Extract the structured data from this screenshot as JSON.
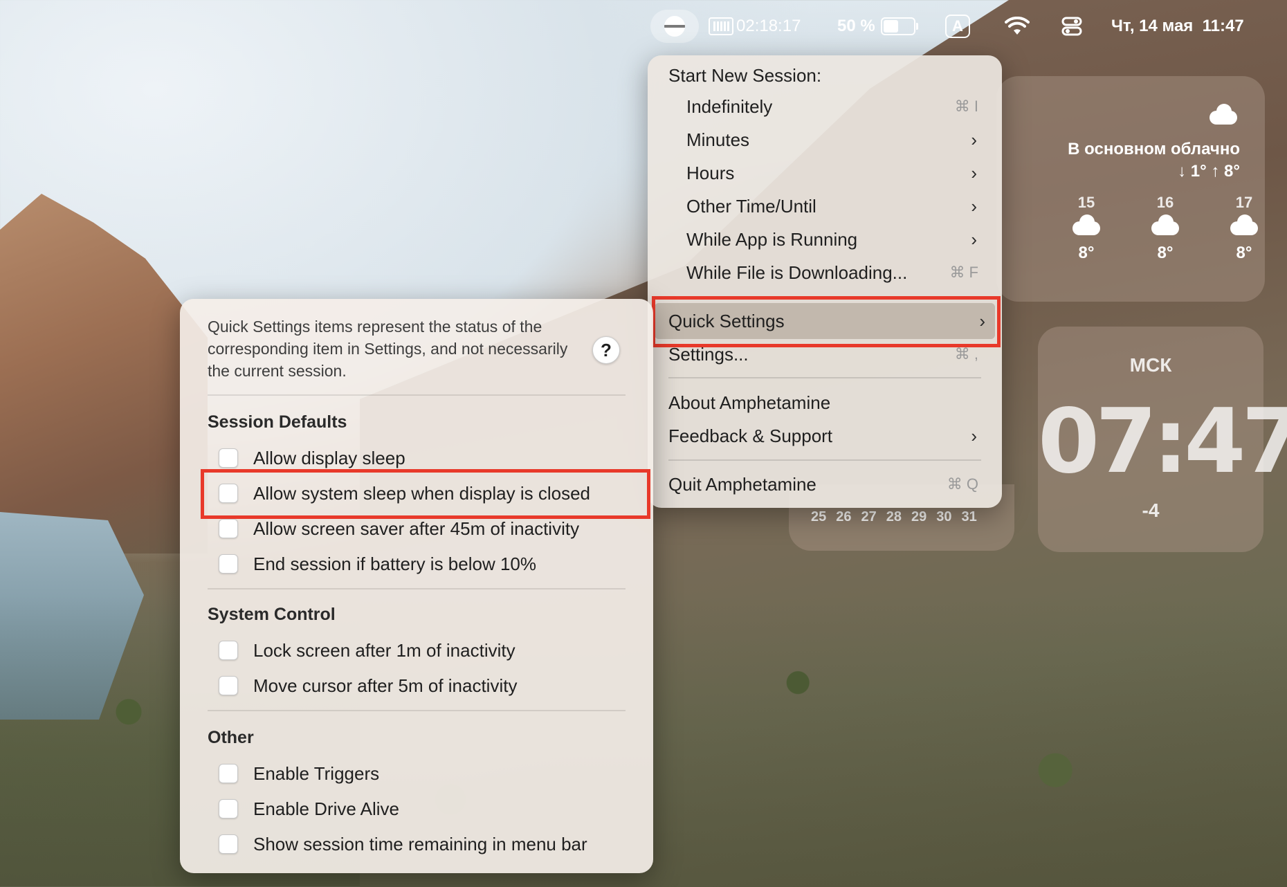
{
  "menubar": {
    "timer": "02:18:17",
    "battery_percent": "50 %",
    "battery_level": 0.5,
    "input_source": "A",
    "datetime": "Чт, 14 мая  11:47"
  },
  "weather": {
    "condition": "В основном облачно",
    "range": "↓ 1° ↑ 8°",
    "forecast": [
      {
        "day": "15",
        "temp": "8°"
      },
      {
        "day": "16",
        "temp": "8°"
      },
      {
        "day": "17",
        "temp": "8°"
      }
    ]
  },
  "clock": {
    "city": "МСК",
    "time": "07:47",
    "offset": "-4"
  },
  "calendar": {
    "days": [
      "25",
      "26",
      "27",
      "28",
      "29",
      "30",
      "31"
    ]
  },
  "menu": {
    "header": "Start New Session:",
    "items": [
      {
        "label": "Indefinitely",
        "shortcut": "⌘ I"
      },
      {
        "label": "Minutes",
        "chevron": "›"
      },
      {
        "label": "Hours",
        "chevron": "›"
      },
      {
        "label": "Other Time/Until",
        "chevron": "›"
      },
      {
        "label": "While App is Running",
        "chevron": "›"
      },
      {
        "label": "While File is Downloading...",
        "shortcut": "⌘ F"
      }
    ],
    "quick_settings": {
      "label": "Quick Settings",
      "chevron": "›"
    },
    "settings": {
      "label": "Settings...",
      "shortcut": "⌘ ,"
    },
    "about": {
      "label": "About Amphetamine"
    },
    "feedback": {
      "label": "Feedback & Support",
      "chevron": "›"
    },
    "quit": {
      "label": "Quit Amphetamine",
      "shortcut": "⌘ Q"
    }
  },
  "quick_settings": {
    "info": "Quick Settings items represent the status of the corresponding item in Settings, and not necessarily the current session.",
    "help": "?",
    "sections": [
      {
        "title": "Session Defaults",
        "items": [
          "Allow display sleep",
          "Allow system sleep when display is closed",
          "Allow screen saver after 45m of inactivity",
          "End session if battery is below 10%"
        ]
      },
      {
        "title": "System Control",
        "items": [
          "Lock screen after 1m of inactivity",
          "Move cursor after 5m of inactivity"
        ]
      },
      {
        "title": "Other",
        "items": [
          "Enable Triggers",
          "Enable Drive Alive",
          "Show session time remaining in menu bar"
        ]
      }
    ]
  },
  "colors": {
    "highlight_box": "#e8392a"
  }
}
